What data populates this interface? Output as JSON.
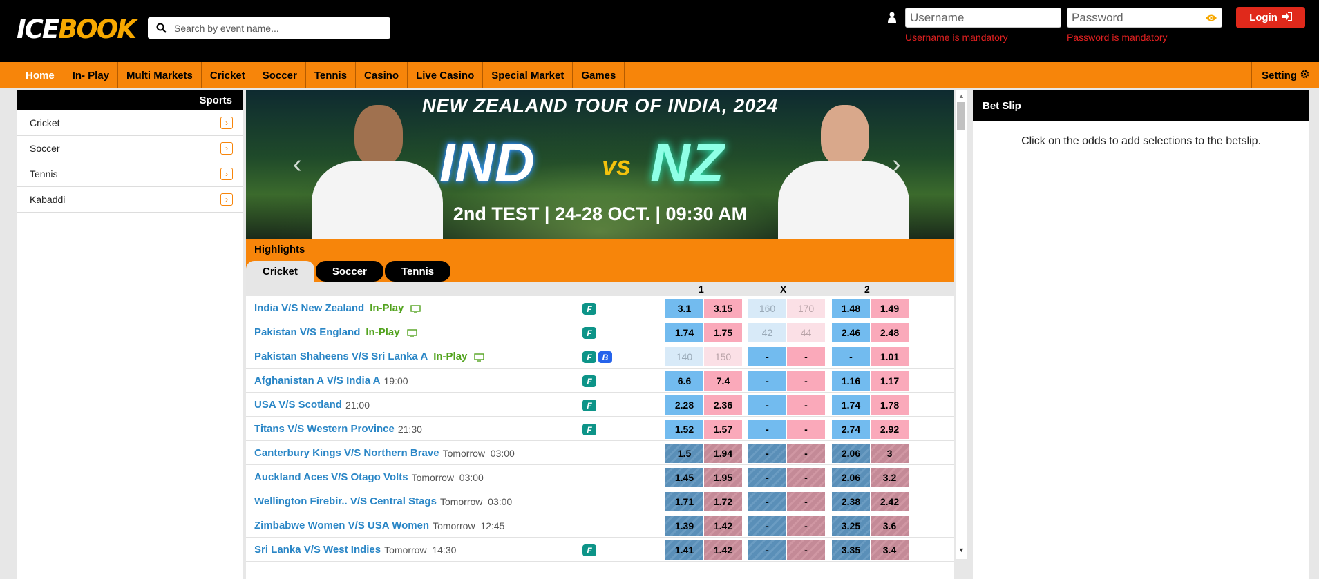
{
  "header": {
    "logo_ice": "ICE",
    "logo_book": "BOOK",
    "search_placeholder": "Search by event name...",
    "username_placeholder": "Username",
    "password_placeholder": "Password",
    "username_error": "Username is mandatory",
    "password_error": "Password is mandatory",
    "login_label": "Login"
  },
  "nav": {
    "items": [
      "Home",
      "In- Play",
      "Multi Markets",
      "Cricket",
      "Soccer",
      "Tennis",
      "Casino",
      "Live Casino",
      "Special Market",
      "Games"
    ],
    "setting_label": "Setting"
  },
  "sidebar": {
    "title": "Sports",
    "items": [
      "Cricket",
      "Soccer",
      "Tennis",
      "Kabaddi"
    ]
  },
  "banner": {
    "title": "NEW ZEALAND TOUR OF INDIA, 2024",
    "team1": "IND",
    "vs": "vs",
    "team2": "NZ",
    "subtitle": "2nd TEST | 24-28 OCT. | 09:30 AM"
  },
  "highlights": {
    "label": "Highlights",
    "tabs": [
      "Cricket",
      "Soccer",
      "Tennis"
    ],
    "columns": [
      "1",
      "X",
      "2"
    ]
  },
  "matches": [
    {
      "name": "India V/S New Zealand",
      "status": "In-Play",
      "time": "",
      "tv": true,
      "badges": [
        "F"
      ],
      "odds": [
        "3.1",
        "3.15",
        "160",
        "170",
        "1.48",
        "1.49"
      ]
    },
    {
      "name": "Pakistan V/S England",
      "status": "In-Play",
      "time": "",
      "tv": true,
      "badges": [
        "F"
      ],
      "odds": [
        "1.74",
        "1.75",
        "42",
        "44",
        "2.46",
        "2.48"
      ]
    },
    {
      "name": "Pakistan Shaheens V/S Sri Lanka A",
      "status": "In-Play",
      "time": "",
      "tv": true,
      "badges": [
        "F",
        "B"
      ],
      "odds": [
        "140",
        "150",
        "-",
        "-",
        "-",
        "1.01"
      ]
    },
    {
      "name": "Afghanistan A V/S India A",
      "status": "",
      "time": "19:00",
      "tv": false,
      "badges": [
        "F"
      ],
      "odds": [
        "6.6",
        "7.4",
        "-",
        "-",
        "1.16",
        "1.17"
      ]
    },
    {
      "name": "USA V/S Scotland",
      "status": "",
      "time": "21:00",
      "tv": false,
      "badges": [
        "F"
      ],
      "odds": [
        "2.28",
        "2.36",
        "-",
        "-",
        "1.74",
        "1.78"
      ]
    },
    {
      "name": "Titans V/S Western Province",
      "status": "",
      "time": "21:30",
      "tv": false,
      "badges": [
        "F"
      ],
      "odds": [
        "1.52",
        "1.57",
        "-",
        "-",
        "2.74",
        "2.92"
      ]
    },
    {
      "name": "Canterbury Kings V/S Northern Brave",
      "status": "",
      "time": "Tomorrow  03:00",
      "tv": false,
      "badges": [],
      "odds": [
        "1.5",
        "1.94",
        "-",
        "-",
        "2.06",
        "3"
      ]
    },
    {
      "name": "Auckland Aces V/S Otago Volts",
      "status": "",
      "time": "Tomorrow  03:00",
      "tv": false,
      "badges": [],
      "odds": [
        "1.45",
        "1.95",
        "-",
        "-",
        "2.06",
        "3.2"
      ]
    },
    {
      "name": "Wellington Firebir.. V/S Central Stags",
      "status": "",
      "time": "Tomorrow  03:00",
      "tv": false,
      "badges": [],
      "odds": [
        "1.71",
        "1.72",
        "-",
        "-",
        "2.38",
        "2.42"
      ]
    },
    {
      "name": "Zimbabwe Women V/S USA Women",
      "status": "",
      "time": "Tomorrow  12:45",
      "tv": false,
      "badges": [],
      "odds": [
        "1.39",
        "1.42",
        "-",
        "-",
        "3.25",
        "3.6"
      ]
    },
    {
      "name": "Sri Lanka V/S West Indies",
      "status": "",
      "time": "Tomorrow  14:30",
      "tv": false,
      "badges": [
        "F"
      ],
      "odds": [
        "1.41",
        "1.42",
        "-",
        "-",
        "3.35",
        "3.4"
      ]
    }
  ],
  "betslip": {
    "title": "Bet Slip",
    "message": "Click on the odds to add selections to the betslip."
  },
  "colors": {
    "accent": "#f7850a",
    "back": "#72bbef",
    "lay": "#faa9ba",
    "link": "#2a86c6",
    "inplay": "#52a31e",
    "login": "#e0291b"
  }
}
